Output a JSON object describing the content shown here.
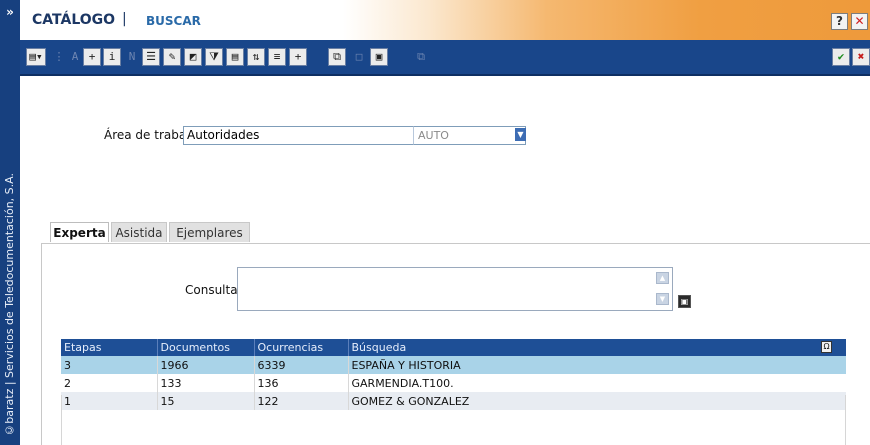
{
  "side": {
    "arrow": "»",
    "vertical_text": "©baratz | Servicios de Teledocumentación, S.A."
  },
  "titlebar": {
    "title": "CATÁLOGO",
    "separator": "|",
    "subtitle": "BUSCAR",
    "help": "?",
    "close": "✕"
  },
  "toolbar": {
    "buttons": [
      {
        "name": "menu-button",
        "glyph": "▤▾"
      },
      {
        "name": "disabled-button-1",
        "glyph": "⋮"
      },
      {
        "name": "font-button",
        "glyph": "A"
      },
      {
        "name": "add-field-button",
        "glyph": "+"
      },
      {
        "name": "info-button",
        "glyph": "i"
      },
      {
        "name": "disabled-button-2",
        "glyph": "N"
      },
      {
        "name": "list-button",
        "glyph": "☰"
      },
      {
        "name": "edit-button",
        "glyph": "✎"
      },
      {
        "name": "record-button",
        "glyph": "◩"
      },
      {
        "name": "filter-button",
        "glyph": "⧩"
      },
      {
        "name": "view-button",
        "glyph": "▤"
      },
      {
        "name": "sort-button",
        "glyph": "⇅"
      },
      {
        "name": "index-button",
        "glyph": "≡"
      },
      {
        "name": "plus-button",
        "glyph": "+"
      },
      {
        "name": "copy-button",
        "glyph": "⧉"
      },
      {
        "name": "disabled-button-3",
        "glyph": "□"
      },
      {
        "name": "paste-button",
        "glyph": "▣"
      },
      {
        "name": "disabled-button-4",
        "glyph": "⧉"
      },
      {
        "name": "accept-button",
        "glyph": "✔"
      },
      {
        "name": "cancel-button",
        "glyph": "✖"
      }
    ]
  },
  "area": {
    "label": "Área de trabajo",
    "value": "Autoridades",
    "code": "AUTO"
  },
  "tabs": [
    "Experta",
    "Asistida",
    "Ejemplares"
  ],
  "consultas": {
    "label": "Consultas",
    "value": ""
  },
  "results": {
    "headers": [
      "Etapas",
      "Documentos",
      "Ocurrencias",
      "Búsqueda"
    ],
    "rows": [
      [
        "3",
        "1966",
        "6339",
        "ESPAÑA Y HISTORIA"
      ],
      [
        "2",
        "133",
        "136",
        "GARMENDIA.T100."
      ],
      [
        "1",
        "15",
        "122",
        "GOMEZ & GONZALEZ"
      ]
    ]
  },
  "colors": {
    "toolbar": "#19468a",
    "selected_row": "#a9d3e8",
    "header": "#1e4f96",
    "accent_orange": "#ee9a3b"
  }
}
